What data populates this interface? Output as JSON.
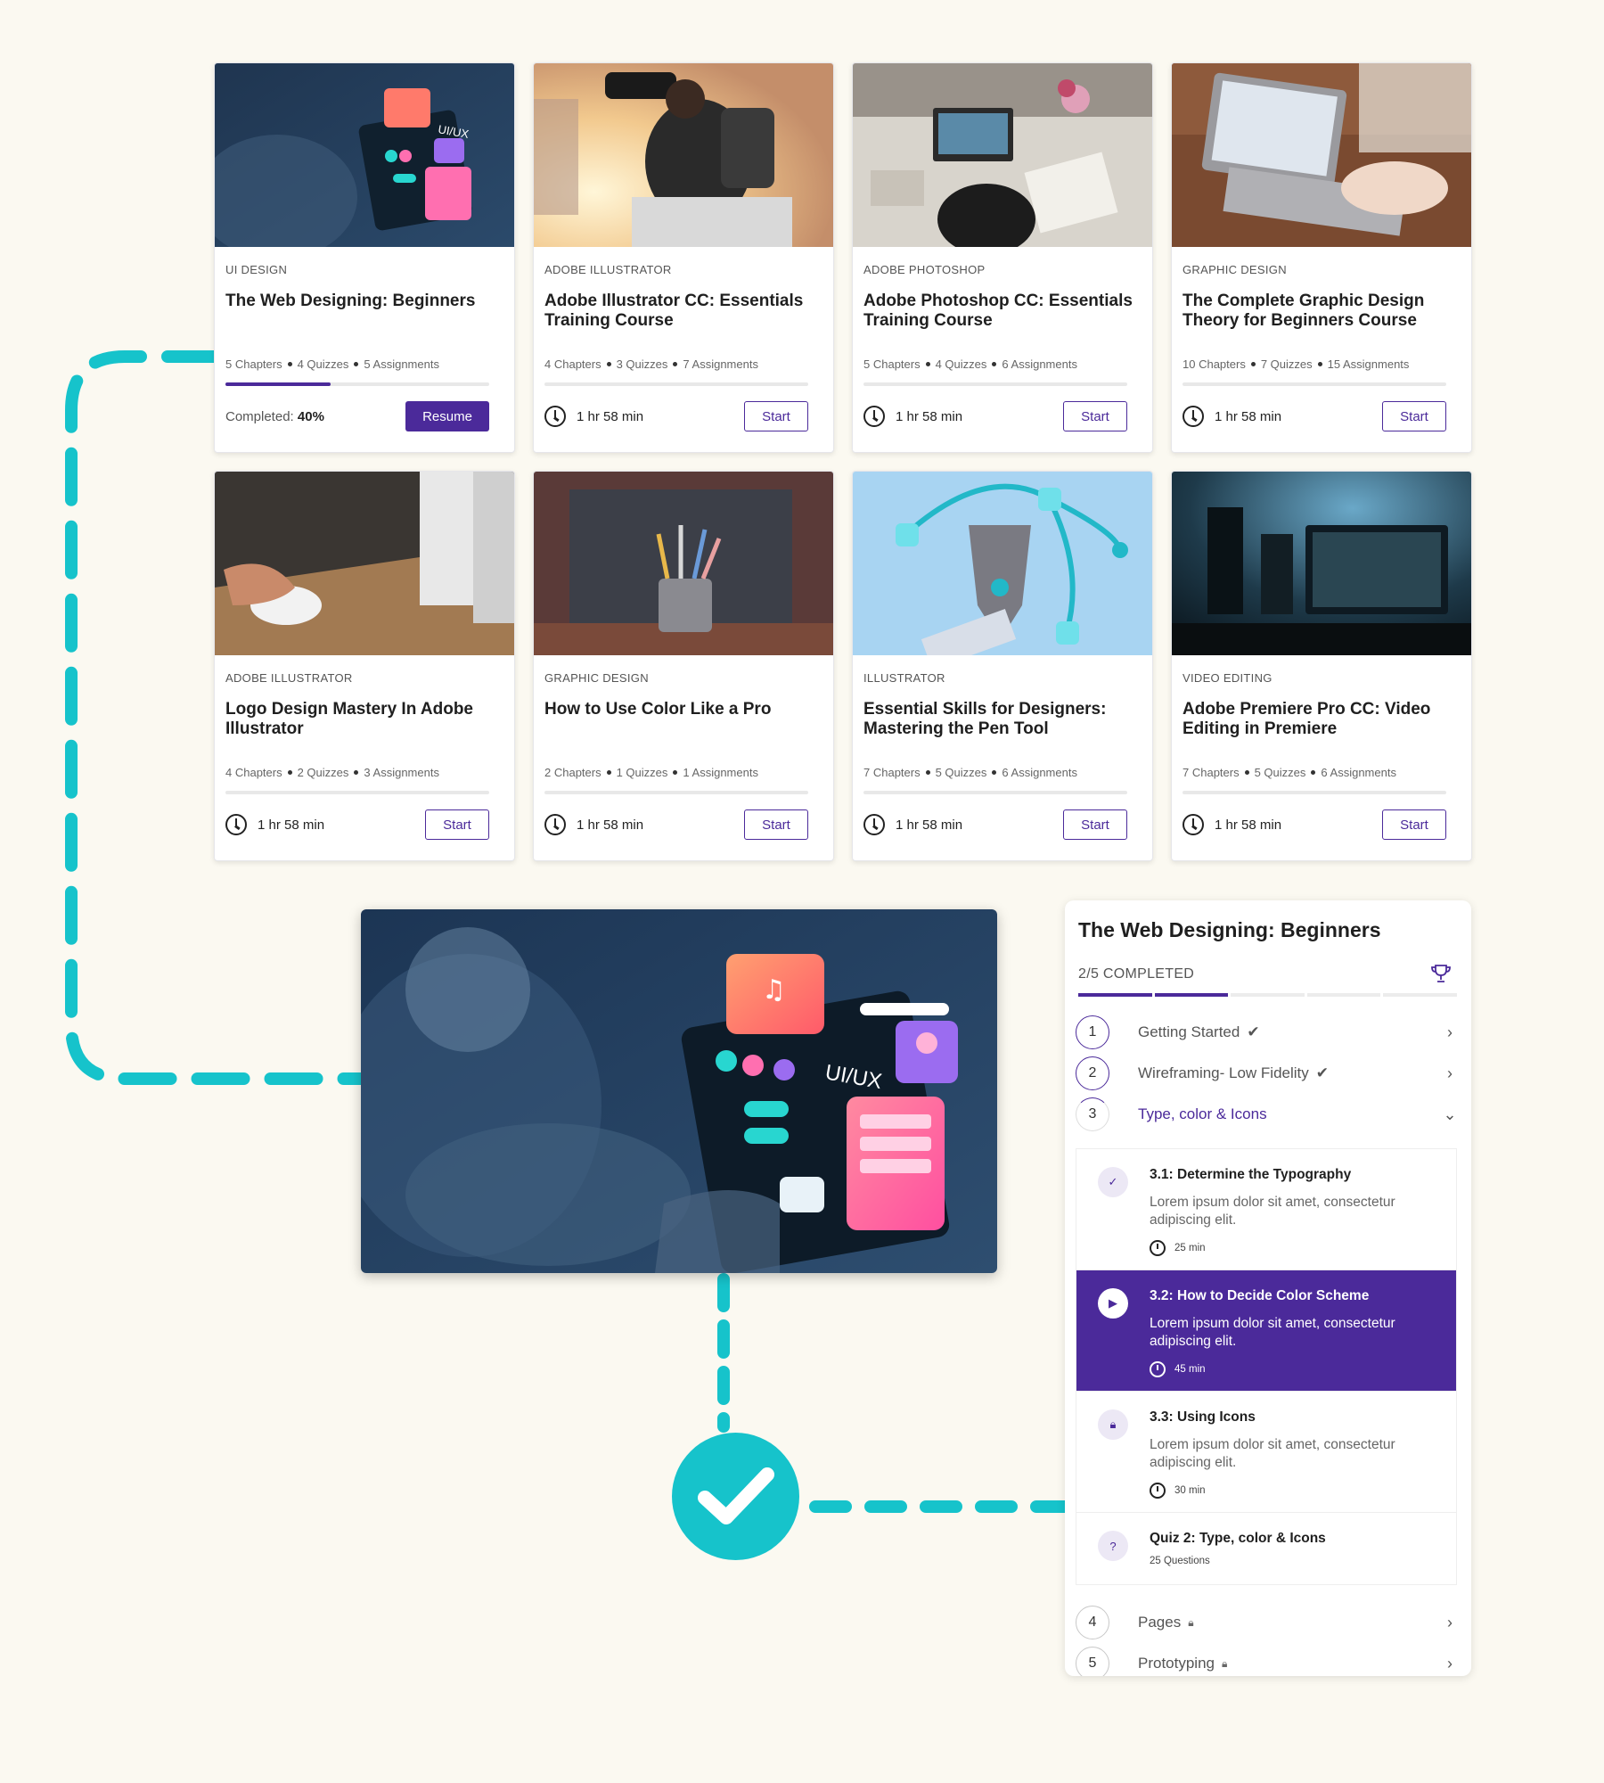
{
  "courses": [
    {
      "category": "UI DESIGN",
      "title": "The Web Designing: Beginners",
      "chapters": "5 Chapters",
      "quizzes": "4 Quizzes",
      "assignments": "5 Assignments",
      "progress": 0.4,
      "completed_label": "Completed:",
      "completed_value": "40%",
      "action": "Resume",
      "image": "ui-ux-laptop"
    },
    {
      "category": "ADOBE ILLUSTRATOR",
      "title": "Adobe Illustrator CC: Essentials Training Course",
      "chapters": "4 Chapters",
      "quizzes": "3 Quizzes",
      "assignments": "7 Assignments",
      "progress": 0,
      "duration": "1 hr 58 min",
      "action": "Start",
      "image": "photographer"
    },
    {
      "category": "ADOBE PHOTOSHOP",
      "title": "Adobe Photoshop CC: Essentials Training Course",
      "chapters": "5 Chapters",
      "quizzes": "4 Quizzes",
      "assignments": "6 Assignments",
      "progress": 0,
      "duration": "1 hr 58 min",
      "action": "Start",
      "image": "design-desk"
    },
    {
      "category": "GRAPHIC DESIGN",
      "title": "The Complete Graphic Design Theory for Beginners Course",
      "chapters": "10 Chapters",
      "quizzes": "7 Quizzes",
      "assignments": "15 Assignments",
      "progress": 0,
      "duration": "1 hr 58 min",
      "action": "Start",
      "image": "laptop-typing"
    },
    {
      "category": "ADOBE ILLUSTRATOR",
      "title": "Logo Design Mastery In Adobe Illustrator",
      "chapters": "4 Chapters",
      "quizzes": "2 Quizzes",
      "assignments": "3 Assignments",
      "progress": 0,
      "duration": "1 hr 58 min",
      "action": "Start",
      "image": "mouse-desk"
    },
    {
      "category": "GRAPHIC DESIGN",
      "title": "How to Use Color Like a Pro",
      "chapters": "2 Chapters",
      "quizzes": "1 Quizzes",
      "assignments": "1 Assignments",
      "progress": 0,
      "duration": "1 hr 58 min",
      "action": "Start",
      "image": "paint-brushes"
    },
    {
      "category": "ILLUSTRATOR",
      "title": "Essential Skills for Designers: Mastering the Pen Tool",
      "chapters": "7 Chapters",
      "quizzes": "5 Quizzes",
      "assignments": "6 Assignments",
      "progress": 0,
      "duration": "1 hr 58 min",
      "action": "Start",
      "image": "pen-tool"
    },
    {
      "category": "VIDEO EDITING",
      "title": "Adobe Premiere Pro CC: Video Editing in Premiere",
      "chapters": "7 Chapters",
      "quizzes": "5 Quizzes",
      "assignments": "6 Assignments",
      "progress": 0,
      "duration": "1 hr 58 min",
      "action": "Start",
      "image": "monitor-setup"
    }
  ],
  "hero": {
    "image": "ui-ux-laptop",
    "overlay_text": "UI/UX"
  },
  "badge": {
    "icon": "check-icon",
    "color": "#16c3cb"
  },
  "panel": {
    "title": "The Web Designing: Beginners",
    "progress_label": "2/5 COMPLETED",
    "completed_steps": 2,
    "total_steps": 5,
    "steps": [
      {
        "num": "1",
        "label": "Getting Started",
        "status": "done"
      },
      {
        "num": "2",
        "label": "Wireframing- Low Fidelity",
        "status": "done"
      },
      {
        "num": "3",
        "label": "Type, color & Icons",
        "status": "active"
      },
      {
        "num": "4",
        "label": "Pages",
        "status": "locked"
      },
      {
        "num": "5",
        "label": "Prototyping",
        "status": "locked"
      }
    ],
    "lessons": [
      {
        "title": "3.1: Determine the Typography",
        "desc": "Lorem ipsum dolor sit amet, consectetur adipiscing elit.",
        "time": "25 min",
        "status": "done"
      },
      {
        "title": "3.2: How to Decide Color Scheme",
        "desc": "Lorem ipsum dolor sit amet, consectetur adipiscing elit.",
        "time": "45 min",
        "status": "playing"
      },
      {
        "title": "3.3: Using Icons",
        "desc": "Lorem ipsum dolor sit amet, consectetur adipiscing elit.",
        "time": "30  min",
        "status": "locked"
      }
    ],
    "quiz": {
      "title": "Quiz 2: Type, color & Icons",
      "sub": "25 Questions"
    }
  },
  "colors": {
    "accent": "#4b2a9a",
    "connector": "#16c3cb",
    "background": "#fbf9f1"
  }
}
